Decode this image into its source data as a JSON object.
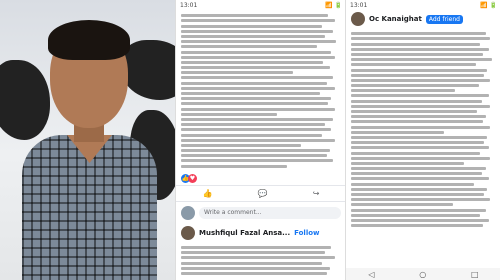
{
  "video": {
    "status": "▶"
  },
  "post1": {
    "status_time": "13:01",
    "status_right": "📶 🔋",
    "reaction_count": "",
    "actions": {
      "like": "👍",
      "comment": "💬",
      "share": "↪"
    },
    "comment_placeholder": "Write a comment...",
    "author": "Mushfiqul Fazal Ansa...",
    "follow_label": "Follow"
  },
  "post2": {
    "status_time": "13:01",
    "status_right": "📶 🔋",
    "author": "Oc Kanaighat",
    "add_friend_label": "Add friend"
  },
  "nav": {
    "back": "◁",
    "home": "○",
    "recents": "□"
  },
  "colors": {
    "accent": "#1877f2",
    "love": "#f33e58"
  }
}
